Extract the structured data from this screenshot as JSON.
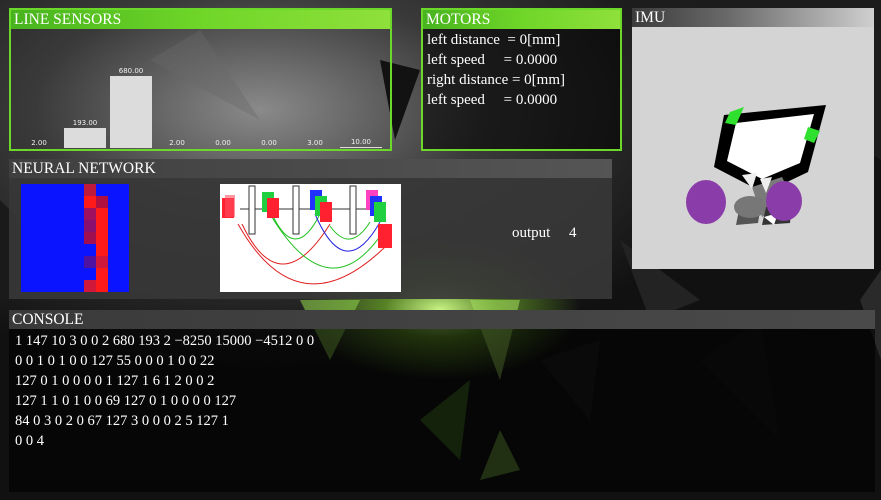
{
  "line_sensors": {
    "title": "LINE SENSORS",
    "max_value": 680,
    "values": [
      2,
      193,
      680,
      2,
      0,
      0,
      3,
      10
    ],
    "labels": [
      "2.00",
      "193.00",
      "680.00",
      "2.00",
      "0.00",
      "0.00",
      "3.00",
      "10.00"
    ]
  },
  "motors": {
    "title": "MOTORS",
    "rows": [
      "left distance  = 0[mm]",
      "left speed     = 0.0000",
      "right distance = 0[mm]",
      "left speed     = 0.0000"
    ]
  },
  "imu": {
    "title": "IMU"
  },
  "neural_network": {
    "title": "NEURAL NETWORK",
    "output_label": "output",
    "output_value": "4"
  },
  "console": {
    "title": "CONSOLE",
    "lines": [
      "1 147 10 3 0 0 2 680 193 2 −8250 15000 −4512 0 0",
      "0 0 1 0 1 0 0 127 55 0 0 0 1 0 0 22",
      "127 0 1 0 0 0 0 1 127 1 6 1 2 0 0 2",
      "127 1 1 0 1 0 0 69 127 0 1 0 0 0 0 127",
      "84 0 3 0 2 0 67 127 3 0 0 0 2 5 127 1",
      "0 0 4"
    ]
  },
  "colors": {
    "accent_green": "#6bd82a",
    "nn_blue": "#0a14ff",
    "nn_red": "#ff1a1a"
  }
}
